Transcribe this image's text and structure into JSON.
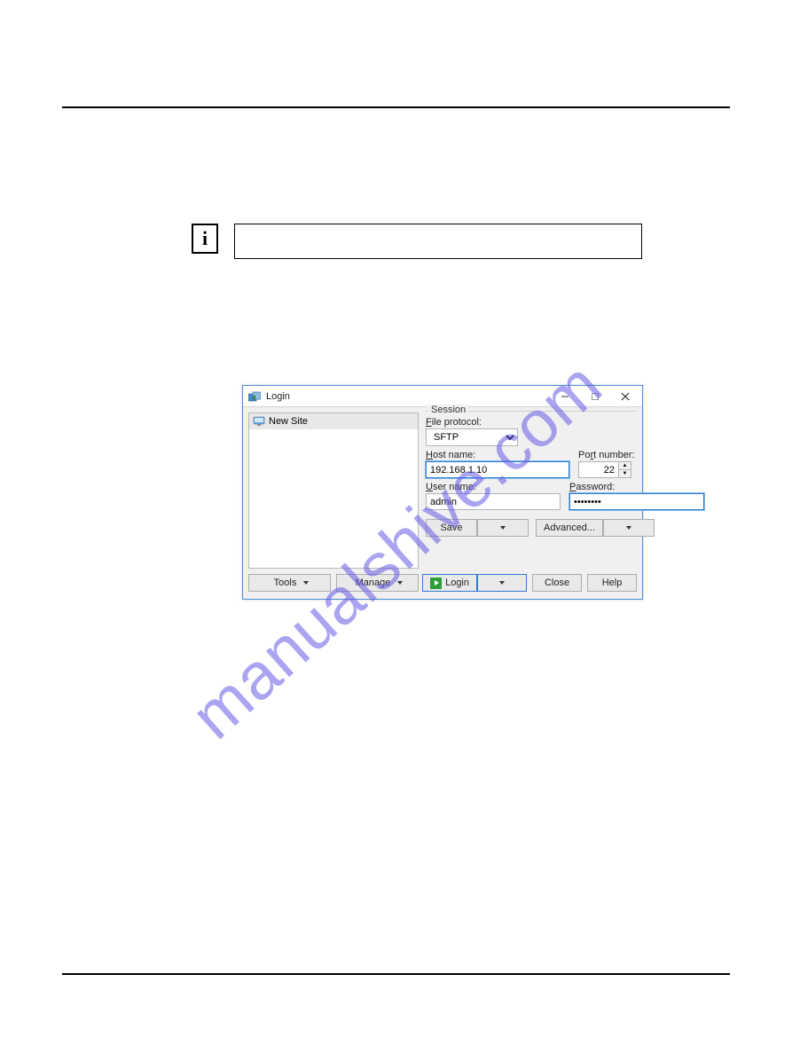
{
  "watermark": "manualshive.com",
  "dialog": {
    "title": "Login",
    "sites": {
      "items": [
        {
          "label": "New Site"
        }
      ]
    },
    "session": {
      "legend": "Session",
      "file_protocol_label": "File protocol:",
      "file_protocol_value": "SFTP",
      "host_label": "Host name:",
      "host_value": "192.168.1.10",
      "port_label": "Port number:",
      "port_value": "22",
      "username_label": "User name:",
      "username_value": "admin",
      "password_label": "Password:",
      "password_value": "••••••••",
      "save_label": "Save",
      "advanced_label": "Advanced..."
    },
    "buttons": {
      "tools": "Tools",
      "manage": "Manage",
      "login": "Login",
      "close": "Close",
      "help": "Help"
    }
  }
}
